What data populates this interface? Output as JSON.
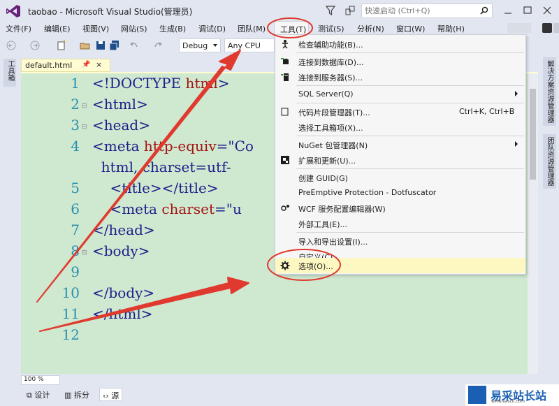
{
  "window": {
    "title": "taobao - Microsoft Visual Studio(管理员)",
    "quick_launch_placeholder": "快速启动 (Ctrl+Q)"
  },
  "menubar": {
    "items": [
      "文件(F)",
      "编辑(E)",
      "视图(V)",
      "网站(S)",
      "生成(B)",
      "调试(D)",
      "团队(M)",
      "工具(T)",
      "测试(S)",
      "分析(N)",
      "窗口(W)",
      "帮助(H)"
    ]
  },
  "toolbar": {
    "configuration": "Debug",
    "platform": "Any CPU"
  },
  "left_panel": {
    "toolbox_label": "工具箱"
  },
  "right_panel": {
    "tabs": [
      "解决方案资源管理器",
      "团队资源管理器"
    ]
  },
  "editor": {
    "tab_label": "default.html",
    "pin_icon": "📌",
    "close_icon": "×",
    "line_numbers": [
      "1",
      "2",
      "3",
      "4",
      "",
      "5",
      "6",
      "7",
      "8",
      "9",
      "10",
      "11",
      "12"
    ],
    "lines": [
      {
        "tag_open": "<!DOCTYPE ",
        "attr": "html",
        "tag_close": ">"
      },
      {
        "tag_open": "<html>"
      },
      {
        "tag_open": "<head>"
      },
      {
        "tag_open": "<meta ",
        "attr": "http-equiv",
        "rest": "=\"Co"
      },
      {
        "indent": "  ",
        "attr": "html",
        "rest": ", charset=utf-"
      },
      {
        "indent": "    ",
        "tag_open": "<title></title>"
      },
      {
        "indent": "    ",
        "tag_open": "<meta ",
        "attr": "charset",
        "rest": "=\"u"
      },
      {
        "tag_open": "</head>"
      },
      {
        "tag_open": "<body>"
      },
      {
        "tag_open": ""
      },
      {
        "tag_open": "</body>"
      },
      {
        "tag_open": "</html>"
      },
      {
        "tag_open": ""
      }
    ]
  },
  "tools_menu": {
    "items": [
      {
        "label": "检查辅助功能(B)...",
        "icon": "accessibility-icon"
      },
      {
        "label": "连接到数据库(D)...",
        "icon": "database-icon"
      },
      {
        "label": "连接到服务器(S)...",
        "icon": "server-icon"
      },
      {
        "label": "SQL Server(Q)",
        "submenu": true
      },
      {
        "label": "代码片段管理器(T)...",
        "shortcut": "Ctrl+K, Ctrl+B",
        "icon": "snippet-icon"
      },
      {
        "label": "选择工具箱项(X)..."
      },
      {
        "label": "NuGet 包管理器(N)",
        "submenu": true
      },
      {
        "label": "扩展和更新(U)...",
        "icon": "extensions-icon"
      },
      {
        "label": "创建 GUID(G)"
      },
      {
        "label": "PreEmptive Protection - Dotfuscator"
      },
      {
        "label": "WCF 服务配置编辑器(W)",
        "icon": "wcf-icon"
      },
      {
        "label": "外部工具(E)..."
      },
      {
        "label": "导入和导出设置(I)..."
      },
      {
        "label": "自定义(C)..."
      },
      {
        "label": "选项(O)...",
        "icon": "gear-icon",
        "highlighted": true
      }
    ]
  },
  "bottom": {
    "zoom": "100 %",
    "views": [
      "设计",
      "拆分",
      "源"
    ]
  },
  "watermark": {
    "text": "易采站长站",
    "url": "www.easck.com"
  },
  "colors": {
    "chrome": "#e1e6f0",
    "editor_bg": "#cfe8d0",
    "menu_bg": "#f6f6f6",
    "highlight": "#fdf7c1",
    "annotation_red": "#e03a2f",
    "vs_purple": "#68217a"
  }
}
